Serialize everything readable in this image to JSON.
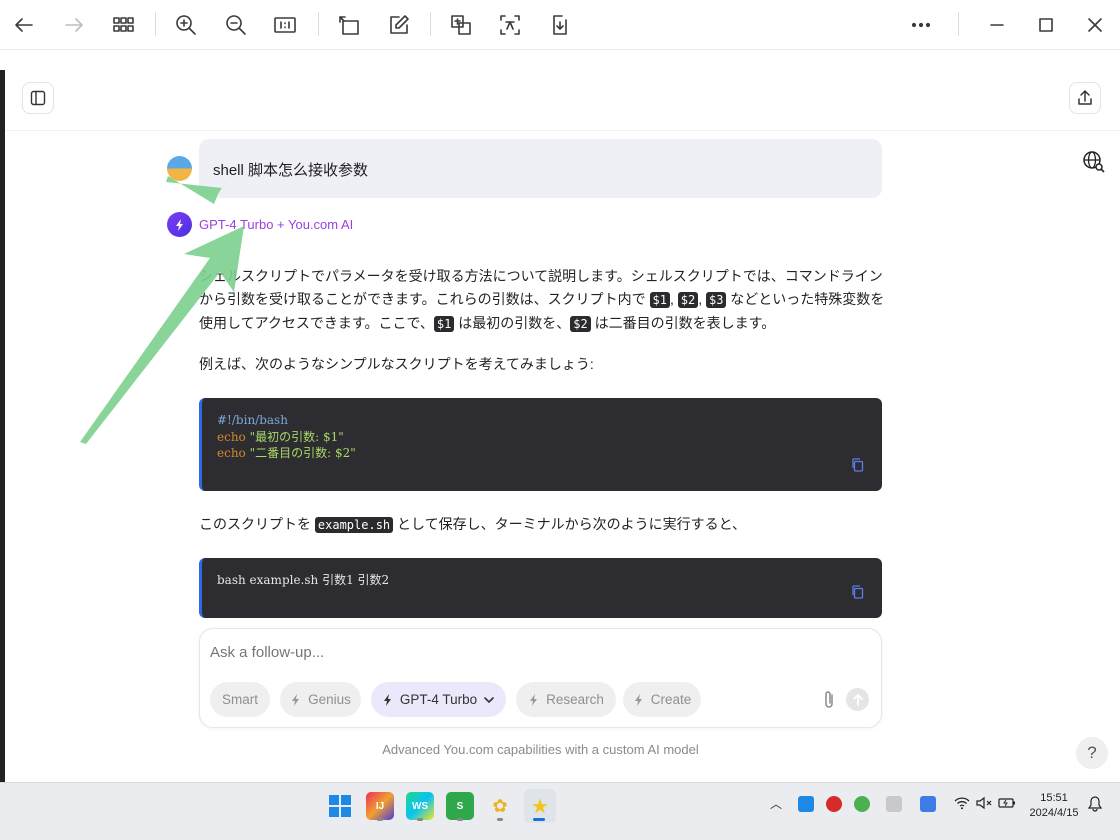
{
  "toolbar": {
    "icons": [
      "back-icon",
      "forward-icon",
      "grid-icon",
      "zoom-in-icon",
      "zoom-out-icon",
      "actual-size-icon",
      "rotate-icon",
      "edit-icon",
      "translate-icon",
      "text-recognize-icon",
      "download-icon",
      "more-icon",
      "minimize-icon",
      "maximize-icon",
      "close-icon"
    ]
  },
  "conversation": {
    "user_message": "shell 脚本怎么接收参数",
    "model_label": "GPT-4 Turbo + You.com AI",
    "answer": {
      "p1_a": "シェルスクリプトでパラメータを受け取る方法について説明します。シェルスクリプトでは、コマンドラインから引数を受け取ることができます。これらの引数は、スクリプト内で ",
      "var1": "$1",
      "sep1": ", ",
      "var2": "$2",
      "sep2": ", ",
      "var3": "$3",
      "p1_b": " などといった特殊変数を使用してアクセスできます。ここで、",
      "var1b": "$1",
      "p1_c": " は最初の引数を、",
      "var2b": "$2",
      "p1_d": " は二番目の引数を表します。",
      "p2": "例えば、次のようなシンプルなスクリプトを考えてみましょう:",
      "code1": {
        "line1": "#!/bin/bash",
        "line2_kw": "echo",
        "line2_str": " \"最初の引数: $1\"",
        "line3_kw": "echo",
        "line3_str": " \"二番目の引数: $2\""
      },
      "p3_a": "このスクリプトを ",
      "p3_code": "example.sh",
      "p3_b": " として保存し、ターミナルから次のように実行すると、",
      "code2": {
        "line1": "bash example.sh 引数1 引数2"
      }
    }
  },
  "composer": {
    "placeholder": "Ask a follow-up...",
    "chips": {
      "smart": "Smart",
      "genius": "Genius",
      "gpt4": "GPT-4 Turbo",
      "research": "Research",
      "create": "Create"
    },
    "footnote": "Advanced You.com capabilities with a custom AI model",
    "help": "?"
  },
  "taskbar": {
    "time": "15:51",
    "date": "2024/4/15",
    "apps": [
      "windows-start-icon",
      "intellij-idea-icon",
      "webstorm-icon",
      "spreadsheet-app-icon",
      "notepad-plus-icon",
      "viewer-app-icon"
    ]
  },
  "colors": {
    "accent": "#9a3fe0",
    "code_bg": "#2d2c31",
    "arrow": "#7ccf8e"
  }
}
